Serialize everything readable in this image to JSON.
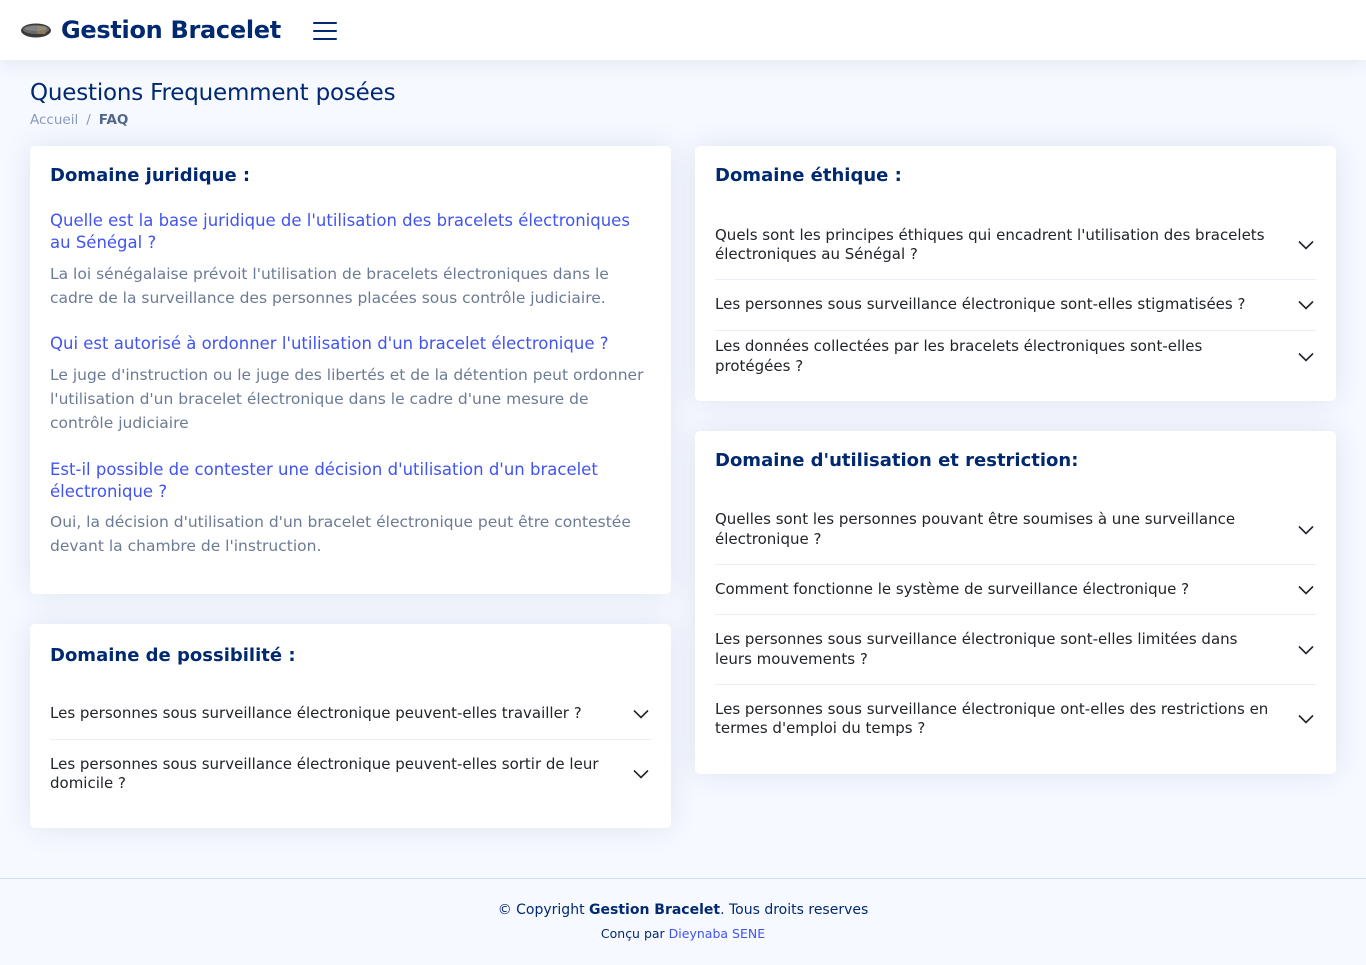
{
  "header": {
    "logo_text": "Gestion Bracelet"
  },
  "page": {
    "title": "Questions Frequemment posées",
    "breadcrumb": [
      "Accueil",
      "/",
      "FAQ"
    ]
  },
  "juridique": {
    "title": "Domaine juridique :",
    "items": [
      {
        "q": "Quelle est la base juridique de l'utilisation des bracelets électroniques au Sénégal ?",
        "a": "La loi sénégalaise prévoit l'utilisation de bracelets électroniques dans le cadre de la surveillance des personnes placées sous contrôle judiciaire."
      },
      {
        "q": "Qui est autorisé à ordonner l'utilisation d'un bracelet électronique ?",
        "a": "Le juge d'instruction ou le juge des libertés et de la détention peut ordonner l'utilisation d'un bracelet électronique dans le cadre d'une mesure de contrôle judiciaire"
      },
      {
        "q": "Est-il possible de contester une décision d'utilisation d'un bracelet électronique ?",
        "a": "Oui, la décision d'utilisation d'un bracelet électronique peut être contestée devant la chambre de l'instruction."
      }
    ]
  },
  "possibilite": {
    "title": "Domaine de possibilité :",
    "items": [
      "Les personnes sous surveillance électronique peuvent-elles travailler ?",
      "Les personnes sous surveillance électronique peuvent-elles sortir de leur domicile ?"
    ]
  },
  "ethique": {
    "title": "Domaine éthique :",
    "items": [
      "Quels sont les principes éthiques qui encadrent l'utilisation des bracelets électroniques au Sénégal ?",
      "Les personnes sous surveillance électronique sont-elles stigmatisées ?",
      "Les données collectées par les bracelets électroniques sont-elles protégées ?"
    ]
  },
  "utilisation": {
    "title": "Domaine d'utilisation et restriction:",
    "items": [
      "Quelles sont les personnes pouvant être soumises à une surveillance électronique ?",
      "Comment fonctionne le système de surveillance électronique ?",
      "Les personnes sous surveillance électronique sont-elles limitées dans leurs mouvements ?",
      "Les personnes sous surveillance électronique ont-elles des restrictions en termes d'emploi du temps ?"
    ]
  },
  "footer": {
    "copyright_prefix": "© Copyright ",
    "copyright_brand": "Gestion Bracelet",
    "copyright_suffix": ". Tous droits reserves",
    "credits_prefix": "Conçu par ",
    "credits_author": "Dieynaba SENE"
  }
}
